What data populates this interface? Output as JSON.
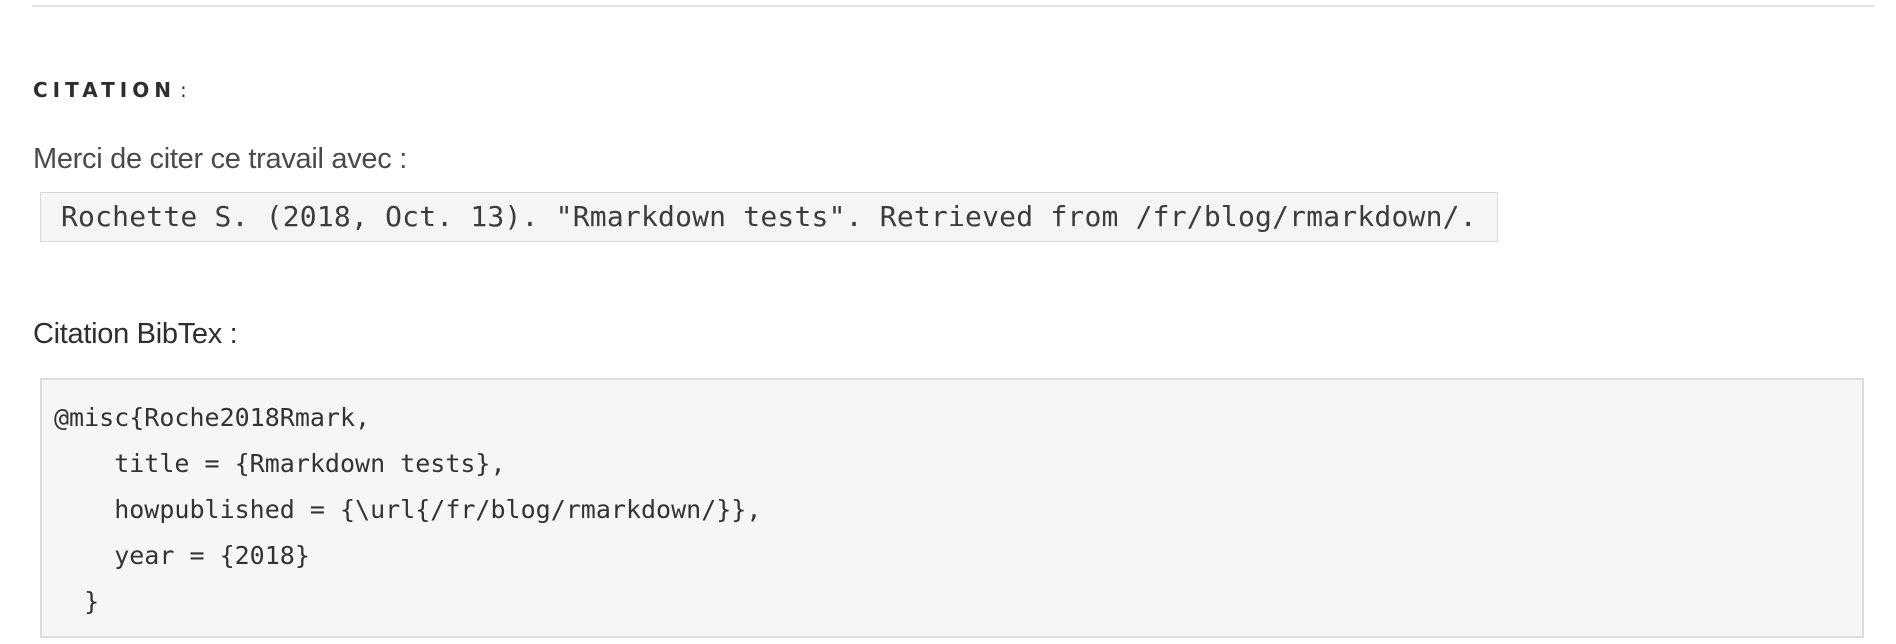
{
  "citation": {
    "heading": "CITATION",
    "heading_suffix": ":",
    "cite_prompt": "Merci de citer ce travail avec :",
    "cite_text": "Rochette S. (2018, Oct. 13). \"Rmarkdown tests\". Retrieved from /fr/blog/rmarkdown/.",
    "bibtex_label": "Citation BibTex :",
    "bibtex_lines": [
      "@misc{Roche2018Rmark,",
      "    title = {Rmarkdown tests},",
      "    howpublished = {\\url{/fr/blog/rmarkdown/}},",
      "    year = {2018}",
      "  }"
    ]
  },
  "colors": {
    "text": "#404040",
    "heading": "#2e2e2e",
    "code_background": "#f6f6f6",
    "code_border": "#dcdcdc",
    "divider": "#e3e3e3"
  }
}
